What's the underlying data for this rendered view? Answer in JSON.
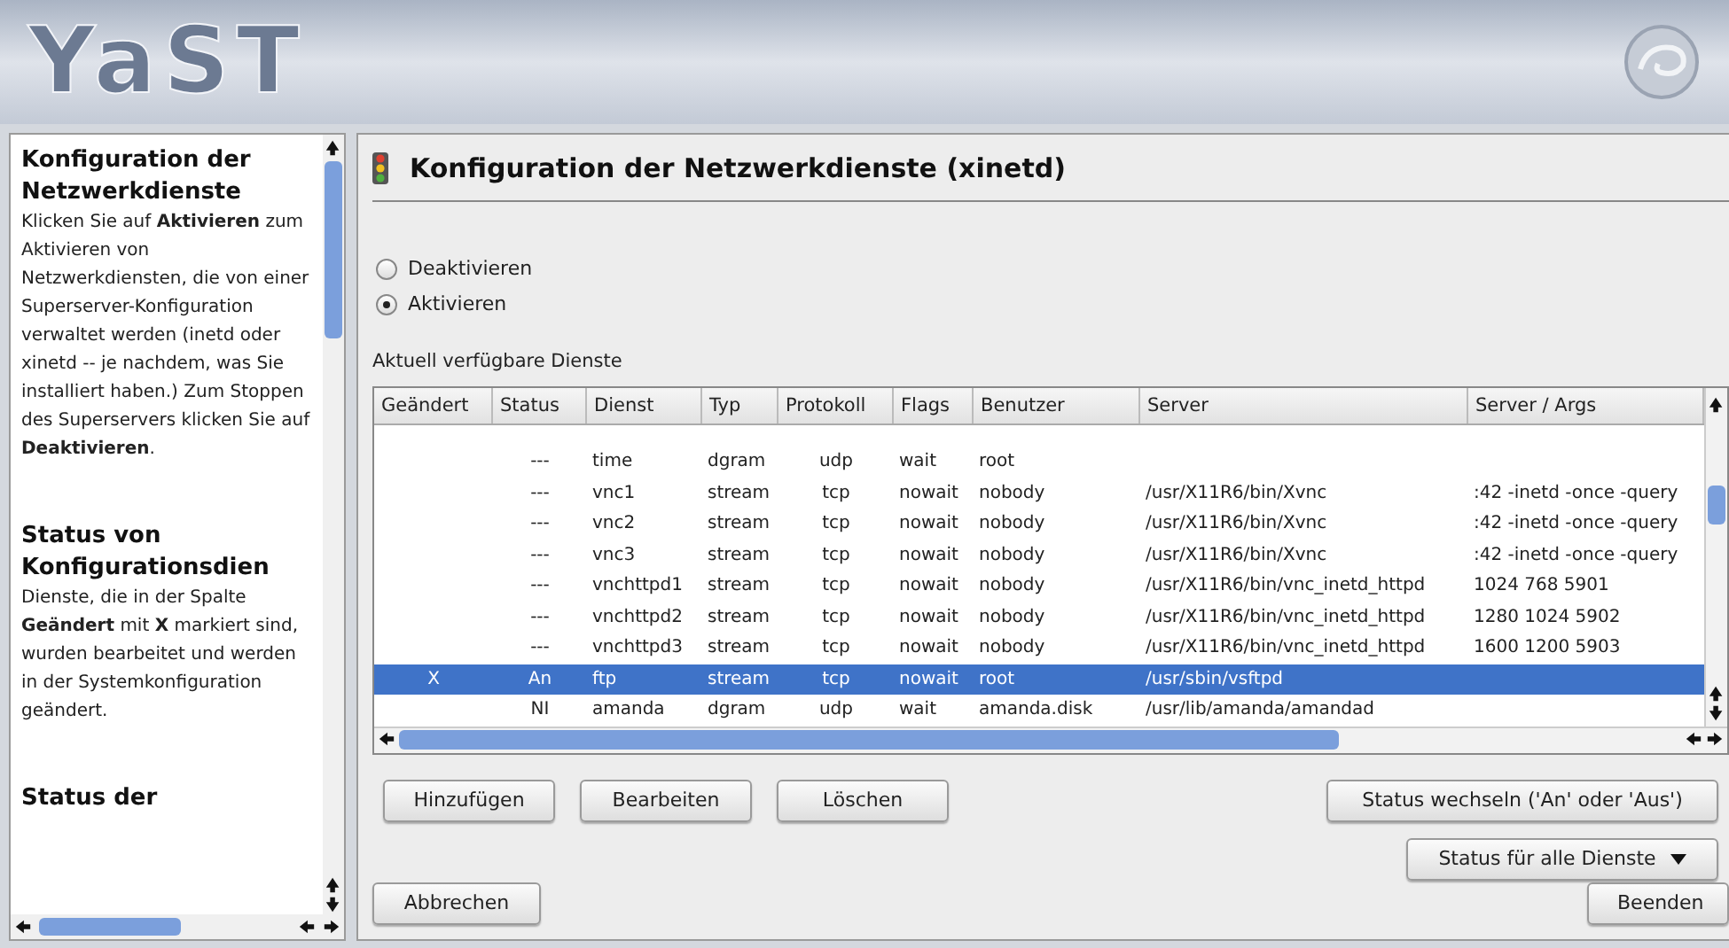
{
  "header": {
    "logo": "YaST"
  },
  "help": [
    {
      "heading": "Konfiguration der Netzwerkdienste",
      "text": "Klicken Sie auf **Aktivieren** zum Aktivieren von Netzwerkdiensten, die von einer Superserver-Konfiguration verwaltet werden (inetd oder xinetd -- je nachdem, was Sie installiert haben.) Zum Stoppen des Superservers klicken Sie auf **Deaktivieren**."
    },
    {
      "heading": "Status von Konfigurationsdien",
      "text": "Dienste, die in der Spalte **Geändert** mit **X** markiert sind, wurden bearbeitet und werden in der Systemkonfiguration geändert."
    },
    {
      "heading": "Status der"
    }
  ],
  "title": "Konfiguration der Netzwerkdienste (xinetd)",
  "radios": [
    {
      "label": "Deaktivieren",
      "selected": false
    },
    {
      "label": "Aktivieren",
      "selected": true
    }
  ],
  "table_label": "Aktuell verfügbare Dienste",
  "table": {
    "columns": [
      "Geändert",
      "Status",
      "Dienst",
      "Typ",
      "Protokoll",
      "Flags",
      "Benutzer",
      "Server",
      "Server / Args"
    ],
    "rows": [
      {
        "cells": [
          "",
          "---",
          "time",
          "dgram",
          "udp",
          "wait",
          "root",
          "",
          ""
        ],
        "selected": false
      },
      {
        "cells": [
          "",
          "---",
          "vnc1",
          "stream",
          "tcp",
          "nowait",
          "nobody",
          "/usr/X11R6/bin/Xvnc",
          ":42 -inetd -once -query"
        ],
        "selected": false
      },
      {
        "cells": [
          "",
          "---",
          "vnc2",
          "stream",
          "tcp",
          "nowait",
          "nobody",
          "/usr/X11R6/bin/Xvnc",
          ":42 -inetd -once -query"
        ],
        "selected": false
      },
      {
        "cells": [
          "",
          "---",
          "vnc3",
          "stream",
          "tcp",
          "nowait",
          "nobody",
          "/usr/X11R6/bin/Xvnc",
          ":42 -inetd -once -query"
        ],
        "selected": false
      },
      {
        "cells": [
          "",
          "---",
          "vnchttpd1",
          "stream",
          "tcp",
          "nowait",
          "nobody",
          "/usr/X11R6/bin/vnc_inetd_httpd",
          "1024 768 5901"
        ],
        "selected": false
      },
      {
        "cells": [
          "",
          "---",
          "vnchttpd2",
          "stream",
          "tcp",
          "nowait",
          "nobody",
          "/usr/X11R6/bin/vnc_inetd_httpd",
          "1280 1024 5902"
        ],
        "selected": false
      },
      {
        "cells": [
          "",
          "---",
          "vnchttpd3",
          "stream",
          "tcp",
          "nowait",
          "nobody",
          "/usr/X11R6/bin/vnc_inetd_httpd",
          "1600 1200 5903"
        ],
        "selected": false
      },
      {
        "cells": [
          "X",
          "An",
          "ftp",
          "stream",
          "tcp",
          "nowait",
          "root",
          "/usr/sbin/vsftpd",
          ""
        ],
        "selected": true
      },
      {
        "cells": [
          "",
          "NI",
          "amanda",
          "dgram",
          "udp",
          "wait",
          "amanda.disk",
          "/usr/lib/amanda/amandad",
          ""
        ],
        "selected": false
      }
    ]
  },
  "row_buttons": [
    "Hinzufügen",
    "Bearbeiten",
    "Löschen"
  ],
  "toggle_button": "Status wechseln ('An' oder 'Aus')",
  "all_button": "Status für alle Dienste",
  "cancel_button": "Abbrechen",
  "finish_button": "Beenden"
}
